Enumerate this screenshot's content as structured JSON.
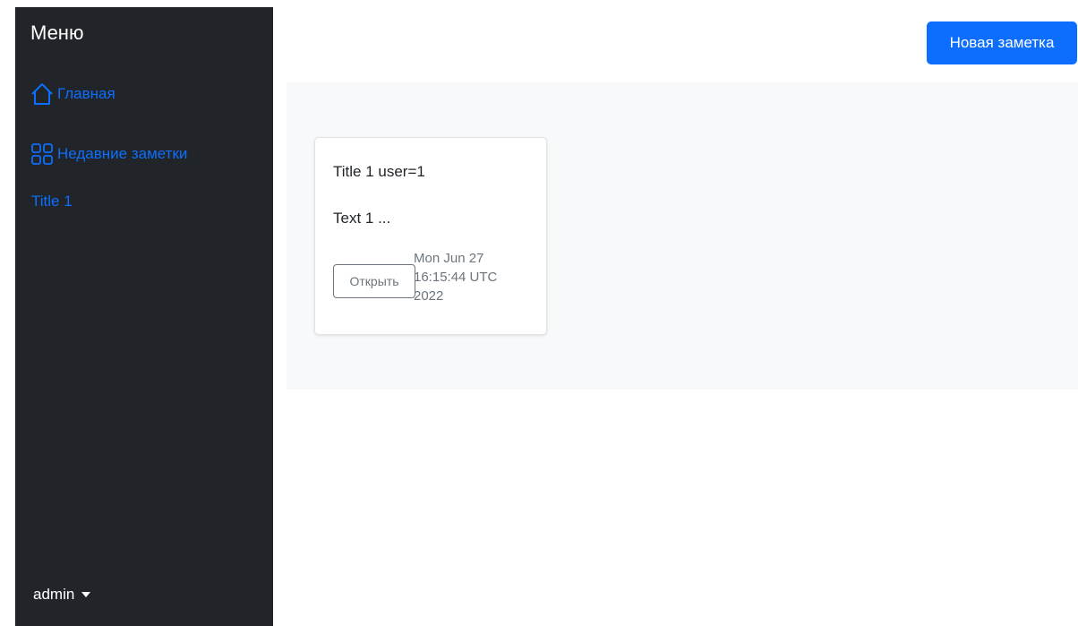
{
  "sidebar": {
    "title": "Меню",
    "items": [
      {
        "label": "Главная",
        "icon": "home-icon"
      },
      {
        "label": "Недавние заметки",
        "icon": "grid-icon"
      },
      {
        "label": "Title 1"
      }
    ],
    "user": "admin"
  },
  "header": {
    "new_note_label": "Новая заметка"
  },
  "notes": [
    {
      "title": "Title 1 user=1",
      "text": "Text 1 ...",
      "open_label": "Открыть",
      "date": "Mon Jun 27 16:15:44 UTC 2022"
    }
  ],
  "colors": {
    "sidebar_bg": "#212529",
    "accent": "#0d6efd",
    "content_bg": "#f8f9fa",
    "muted": "#6c757d"
  }
}
